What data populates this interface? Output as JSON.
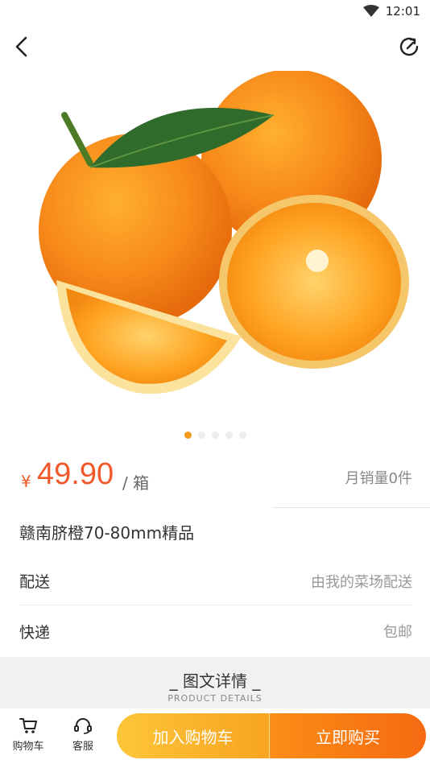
{
  "status_bar": {
    "time": "12:01",
    "icons": [
      "wifi-icon",
      "signal-icon"
    ]
  },
  "nav": {
    "back_icon": "back-arrow-icon",
    "share_icon": "share-refresh-icon"
  },
  "gallery": {
    "image_subject": "oranges-photo",
    "total_slides": 5,
    "active_slide": 1
  },
  "price": {
    "currency": "¥",
    "amount": "49.90",
    "unit": "/ 箱",
    "sales": "月销量0件"
  },
  "product": {
    "name": "赣南脐橙70-80mm精品"
  },
  "info_rows": [
    {
      "label": "配送",
      "value": "由我的菜场配送"
    },
    {
      "label": "快递",
      "value": "包邮"
    }
  ],
  "details": {
    "title": "_ 图文详情 _",
    "subtitle": "PRODUCT DETAILS"
  },
  "bottom_bar": {
    "cart_label": "购物车",
    "service_label": "客服",
    "add_to_cart": "加入购物车",
    "buy_now": "立即购买"
  },
  "colors": {
    "price": "#f2592a",
    "accent": "#f39a1a",
    "add_btn": "#fcc53a",
    "buy_btn": "#f56a12"
  }
}
